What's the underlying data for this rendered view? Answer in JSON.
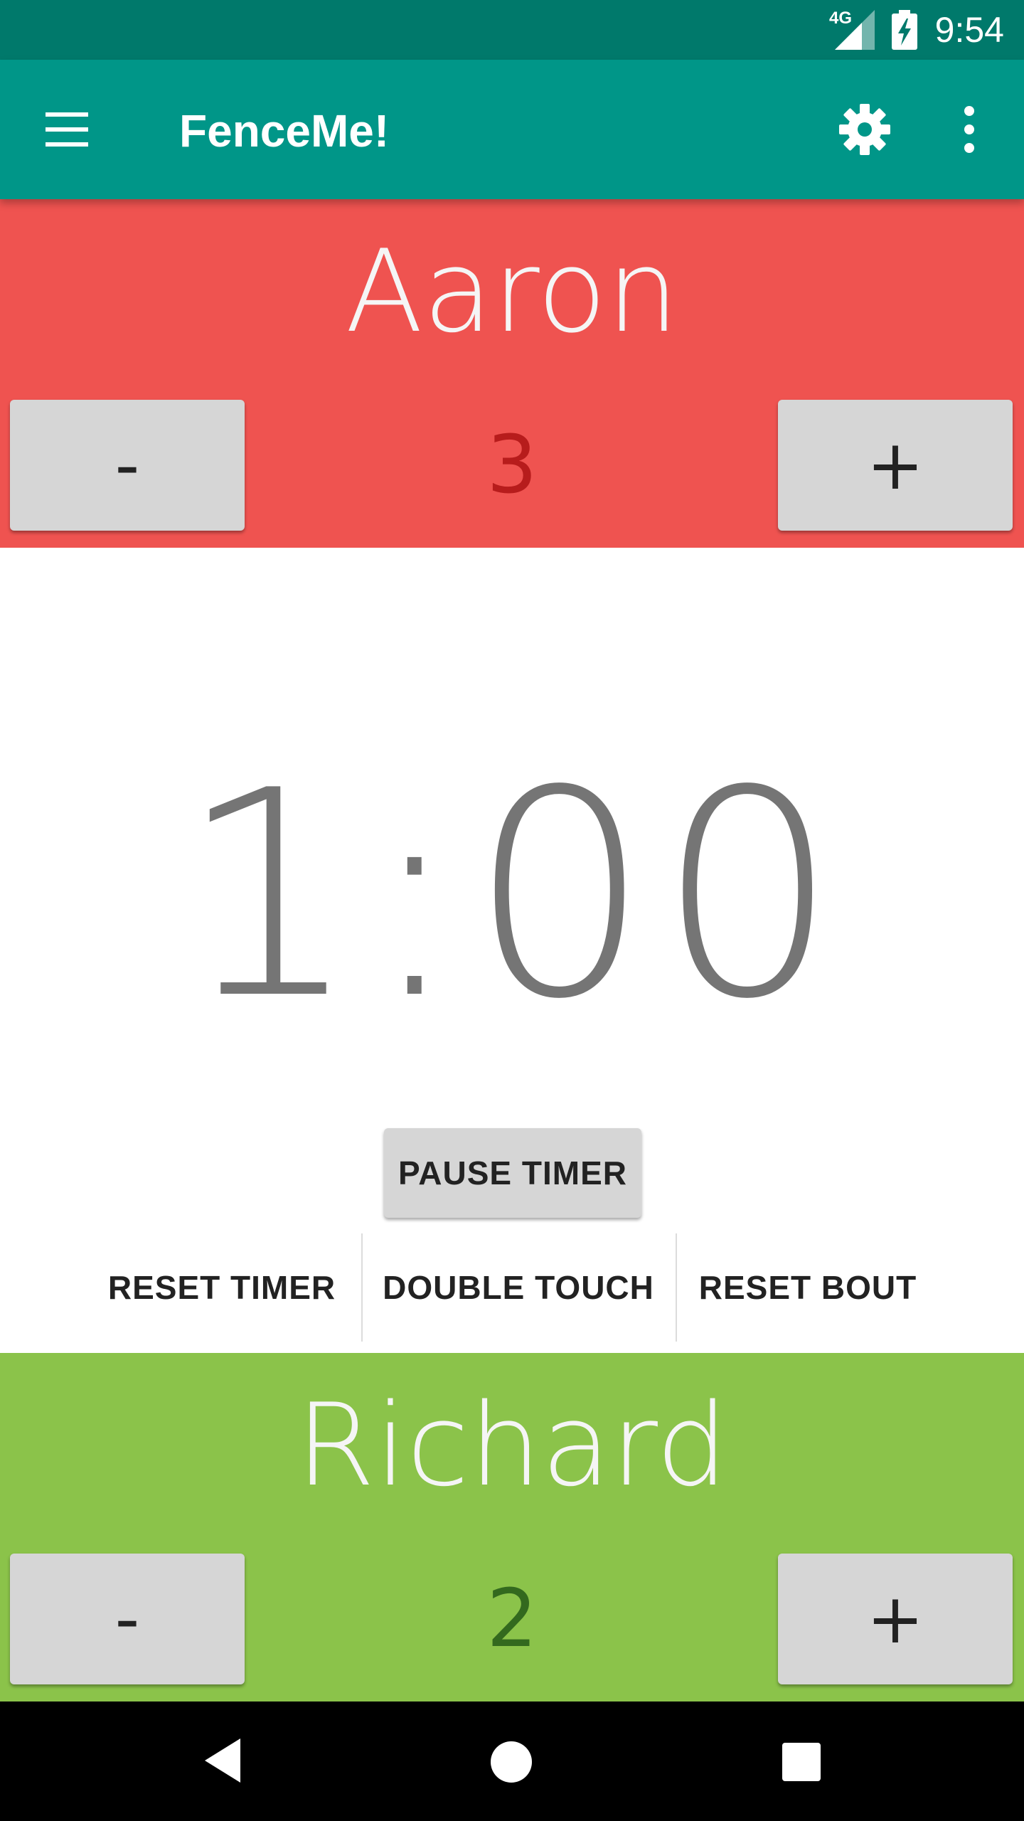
{
  "status_bar": {
    "network_label": "4G",
    "time": "9:54"
  },
  "app_bar": {
    "title": "FenceMe!",
    "menu_icon": "hamburger-menu-icon",
    "settings_icon": "gear-icon",
    "overflow_icon": "more-vert-icon"
  },
  "fencer1": {
    "name": "Aaron",
    "score": "3",
    "minus_label": "-",
    "plus_label": "+",
    "panel_color": "#ef5350",
    "score_color": "#b71c1c"
  },
  "timer": {
    "display": "1:00",
    "pause_label": "PAUSE TIMER"
  },
  "actions": {
    "reset_timer_label": "RESET TIMER",
    "double_touch_label": "DOUBLE TOUCH",
    "reset_bout_label": "RESET BOUT"
  },
  "fencer2": {
    "name": "Richard",
    "score": "2",
    "minus_label": "-",
    "plus_label": "+",
    "panel_color": "#8bc34a",
    "score_color": "#33691e"
  },
  "nav_bar": {
    "back_icon": "back-triangle-icon",
    "home_icon": "home-circle-icon",
    "recents_icon": "recents-square-icon"
  }
}
